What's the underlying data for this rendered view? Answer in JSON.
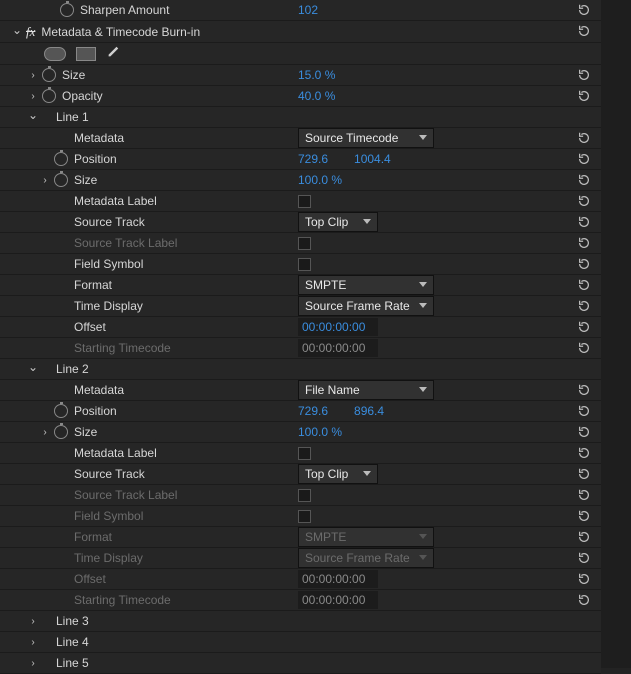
{
  "top": {
    "sharpen_label": "Sharpen Amount",
    "sharpen_value": "102"
  },
  "effect": {
    "title": "Metadata & Timecode Burn-in",
    "size_label": "Size",
    "size_value": "15.0 %",
    "opacity_label": "Opacity",
    "opacity_value": "40.0 %",
    "line1": {
      "title": "Line 1",
      "metadata_label": "Metadata",
      "metadata_value": "Source Timecode",
      "position_label": "Position",
      "position_x": "729.6",
      "position_y": "1004.4",
      "size_label": "Size",
      "size_value": "100.0 %",
      "metalabel_label": "Metadata Label",
      "sourcetrack_label": "Source Track",
      "sourcetrack_value": "Top Clip",
      "sourcetracklabel_label": "Source Track Label",
      "fieldsym_label": "Field Symbol",
      "format_label": "Format",
      "format_value": "SMPTE",
      "timedisp_label": "Time Display",
      "timedisp_value": "Source Frame Rate",
      "offset_label": "Offset",
      "offset_value": "00:00:00:00",
      "starttc_label": "Starting Timecode",
      "starttc_value": "00:00:00:00"
    },
    "line2": {
      "title": "Line 2",
      "metadata_label": "Metadata",
      "metadata_value": "File Name",
      "position_label": "Position",
      "position_x": "729.6",
      "position_y": "896.4",
      "size_label": "Size",
      "size_value": "100.0 %",
      "metalabel_label": "Metadata Label",
      "sourcetrack_label": "Source Track",
      "sourcetrack_value": "Top Clip",
      "sourcetracklabel_label": "Source Track Label",
      "fieldsym_label": "Field Symbol",
      "format_label": "Format",
      "format_value": "SMPTE",
      "timedisp_label": "Time Display",
      "timedisp_value": "Source Frame Rate",
      "offset_label": "Offset",
      "offset_value": "00:00:00:00",
      "starttc_label": "Starting Timecode",
      "starttc_value": "00:00:00:00"
    },
    "line3_title": "Line 3",
    "line4_title": "Line 4",
    "line5_title": "Line 5"
  }
}
